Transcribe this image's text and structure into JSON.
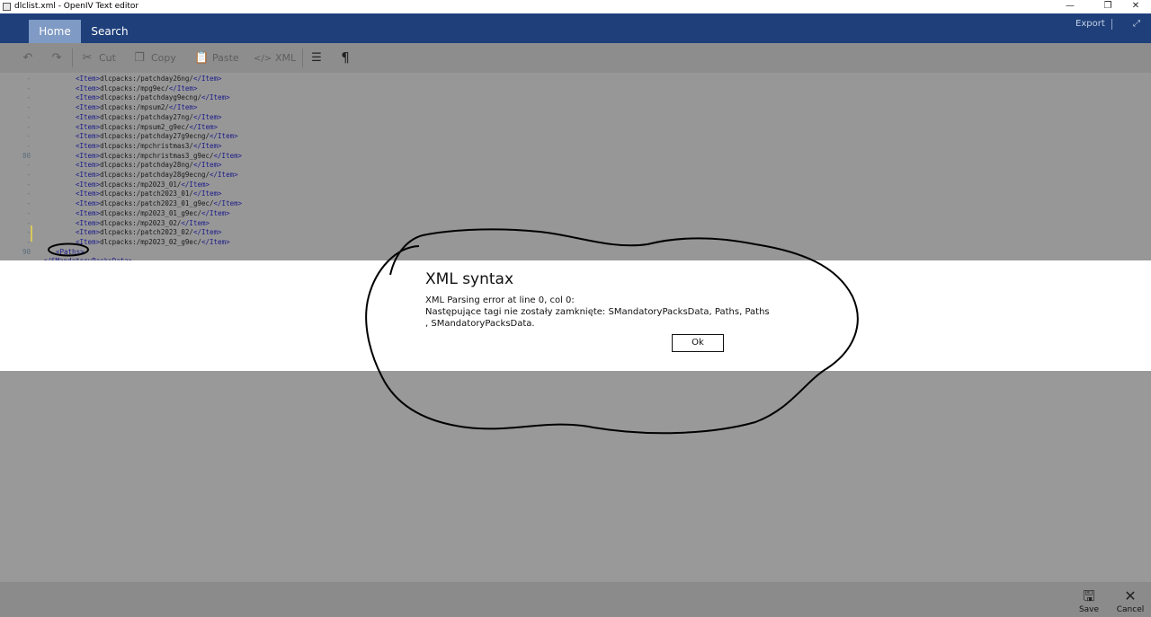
{
  "window": {
    "title": "dlclist.xml - OpenIV Text editor",
    "controls": [
      "—",
      "❐",
      "✕"
    ]
  },
  "ribbon": {
    "tabs": [
      {
        "label": "Home",
        "active": true
      },
      {
        "label": "Search",
        "active": false
      }
    ],
    "export_label": "Export",
    "expand_glyph": "⤢"
  },
  "toolbar": {
    "undo_icon": "↶",
    "redo_icon": "↷",
    "cut_label": "Cut",
    "cut_icon": "✂",
    "copy_label": "Copy",
    "copy_icon": "❐",
    "paste_label": "Paste",
    "paste_icon": "📋",
    "xml_label": "XML",
    "xml_icon": "</>",
    "format_icon": "☰",
    "pilcrow_icon": "¶"
  },
  "editor": {
    "lines": [
      {
        "ln": "-",
        "pre": "<Item>",
        "mid": "dlcpacks:/patchday26ng/",
        "post": "</Item>"
      },
      {
        "ln": "-",
        "pre": "<Item>",
        "mid": "dlcpacks:/mpg9ec/",
        "post": "</Item>"
      },
      {
        "ln": "-",
        "pre": "<Item>",
        "mid": "dlcpacks:/patchdayg9ecng/",
        "post": "</Item>"
      },
      {
        "ln": "-",
        "pre": "<Item>",
        "mid": "dlcpacks:/mpsum2/",
        "post": "</Item>"
      },
      {
        "ln": "-",
        "pre": "<Item>",
        "mid": "dlcpacks:/patchday27ng/",
        "post": "</Item>"
      },
      {
        "ln": "-",
        "pre": "<Item>",
        "mid": "dlcpacks:/mpsum2_g9ec/",
        "post": "</Item>"
      },
      {
        "ln": "-",
        "pre": "<Item>",
        "mid": "dlcpacks:/patchday27g9ecng/",
        "post": "</Item>"
      },
      {
        "ln": "-",
        "pre": "<Item>",
        "mid": "dlcpacks:/mpchristmas3/",
        "post": "</Item>"
      },
      {
        "ln": "80",
        "pre": "<Item>",
        "mid": "dlcpacks:/mpchristmas3_g9ec/",
        "post": "</Item>"
      },
      {
        "ln": "-",
        "pre": "<Item>",
        "mid": "dlcpacks:/patchday28ng/",
        "post": "</Item>"
      },
      {
        "ln": "-",
        "pre": "<Item>",
        "mid": "dlcpacks:/patchday28g9ecng/",
        "post": "</Item>"
      },
      {
        "ln": "-",
        "pre": "<Item>",
        "mid": "dlcpacks:/mp2023_01/",
        "post": "</Item>"
      },
      {
        "ln": "-",
        "pre": "<Item>",
        "mid": "dlcpacks:/patch2023_01/",
        "post": "</Item>"
      },
      {
        "ln": "-",
        "pre": "<Item>",
        "mid": "dlcpacks:/patch2023_01_g9ec/",
        "post": "</Item>"
      },
      {
        "ln": "-",
        "pre": "<Item>",
        "mid": "dlcpacks:/mp2023_01_g9ec/",
        "post": "</Item>"
      },
      {
        "ln": "-",
        "pre": "<Item>",
        "mid": "dlcpacks:/mp2023_02/",
        "post": "</Item>"
      },
      {
        "ln": "-",
        "pre": "<Item>",
        "mid": "dlcpacks:/patch2023_02/",
        "post": "</Item>"
      },
      {
        "ln": "-",
        "pre": "<Item>",
        "mid": "dlcpacks:/mp2023_02_g9ec/",
        "post": "</Item>"
      },
      {
        "ln": "90",
        "pre": "<Paths>",
        "mid": "",
        "post": ""
      },
      {
        "ln": "",
        "pre": "</SMandatoryPacksData>",
        "mid": "",
        "post": ""
      }
    ]
  },
  "dialog": {
    "title": "XML syntax",
    "message_line1": "XML Parsing error at line 0, col 0:",
    "message_line2": "Następujące tagi nie zostały zamknięte: SMandatoryPacksData, Paths, Paths",
    "message_line3": ", SMandatoryPacksData.",
    "ok_label": "Ok"
  },
  "bottombar": {
    "save_label": "Save",
    "save_icon": "🖫",
    "cancel_label": "Cancel",
    "cancel_icon": "✕"
  }
}
